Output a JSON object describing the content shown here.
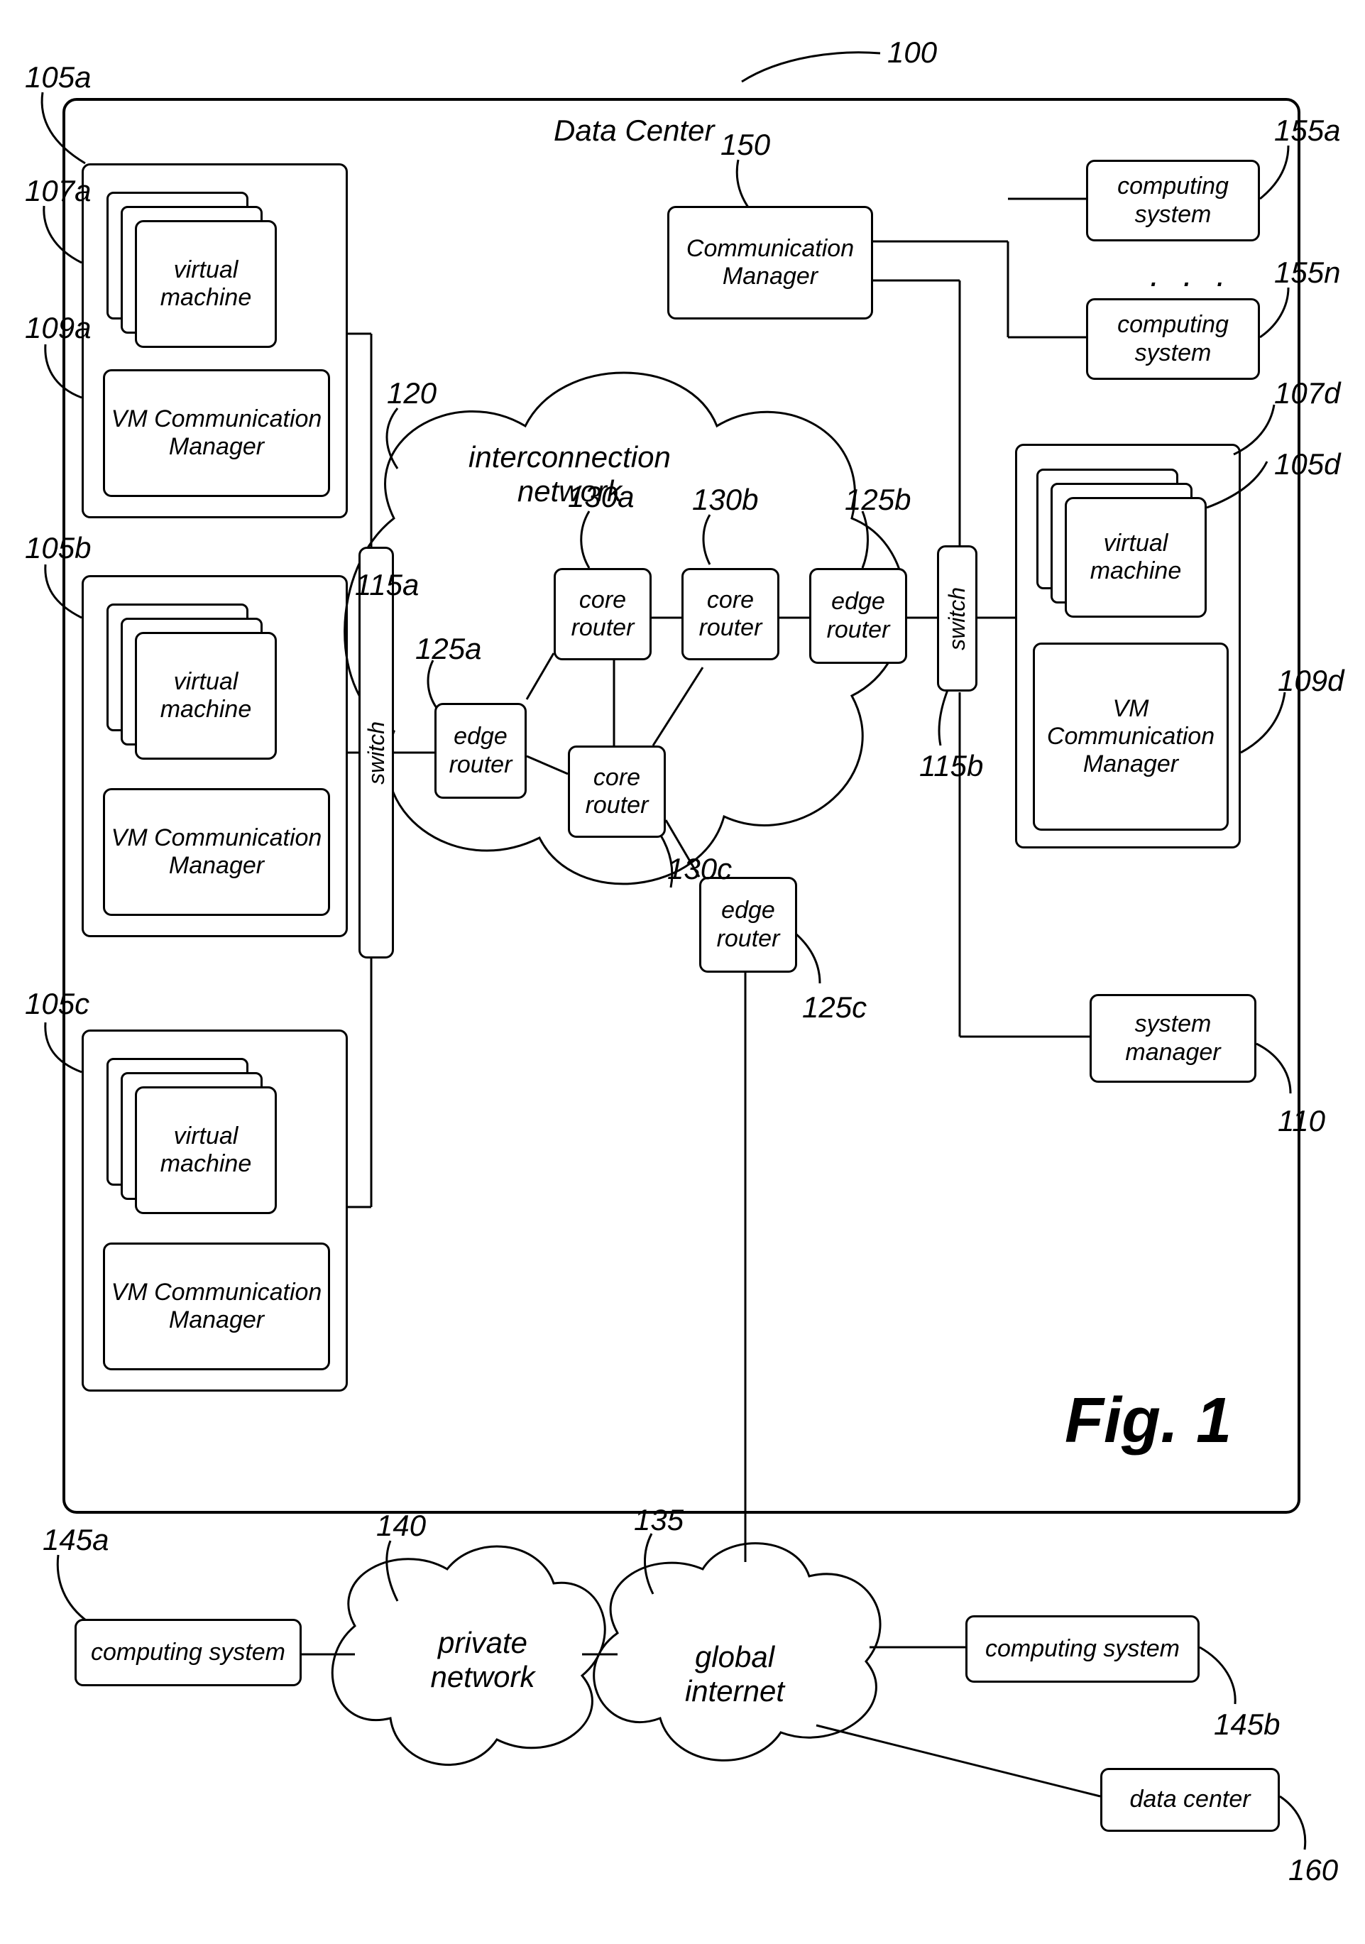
{
  "figure_label": "Fig. 1",
  "data_center_title": "Data Center",
  "interconnection_label": "interconnection\nnetwork",
  "labels": {
    "virtual_machine": "virtual\nmachine",
    "vm_comm_manager": "VM Communication\nManager",
    "comm_manager": "Communication\nManager",
    "computing_system": "computing\nsystem",
    "computing_system_single": "computing system",
    "system_manager": "system\nmanager",
    "switch": "switch",
    "edge_router": "edge\nrouter",
    "core_router": "core\nrouter",
    "global_internet": "global internet",
    "private_network": "private\nnetwork",
    "data_center_ext": "data center",
    "ellipsis": ". . ."
  },
  "refs": {
    "r100": "100",
    "r105a": "105a",
    "r107a": "107a",
    "r109a": "109a",
    "r105b": "105b",
    "r105c": "105c",
    "r105d": "105d",
    "r107d": "107d",
    "r109d": "109d",
    "r110": "110",
    "r115a": "115a",
    "r115b": "115b",
    "r120": "120",
    "r125a": "125a",
    "r125b": "125b",
    "r125c": "125c",
    "r130a": "130a",
    "r130b": "130b",
    "r130c": "130c",
    "r135": "135",
    "r140": "140",
    "r145a": "145a",
    "r145b": "145b",
    "r150": "150",
    "r155a": "155a",
    "r155n": "155n",
    "r160": "160"
  }
}
